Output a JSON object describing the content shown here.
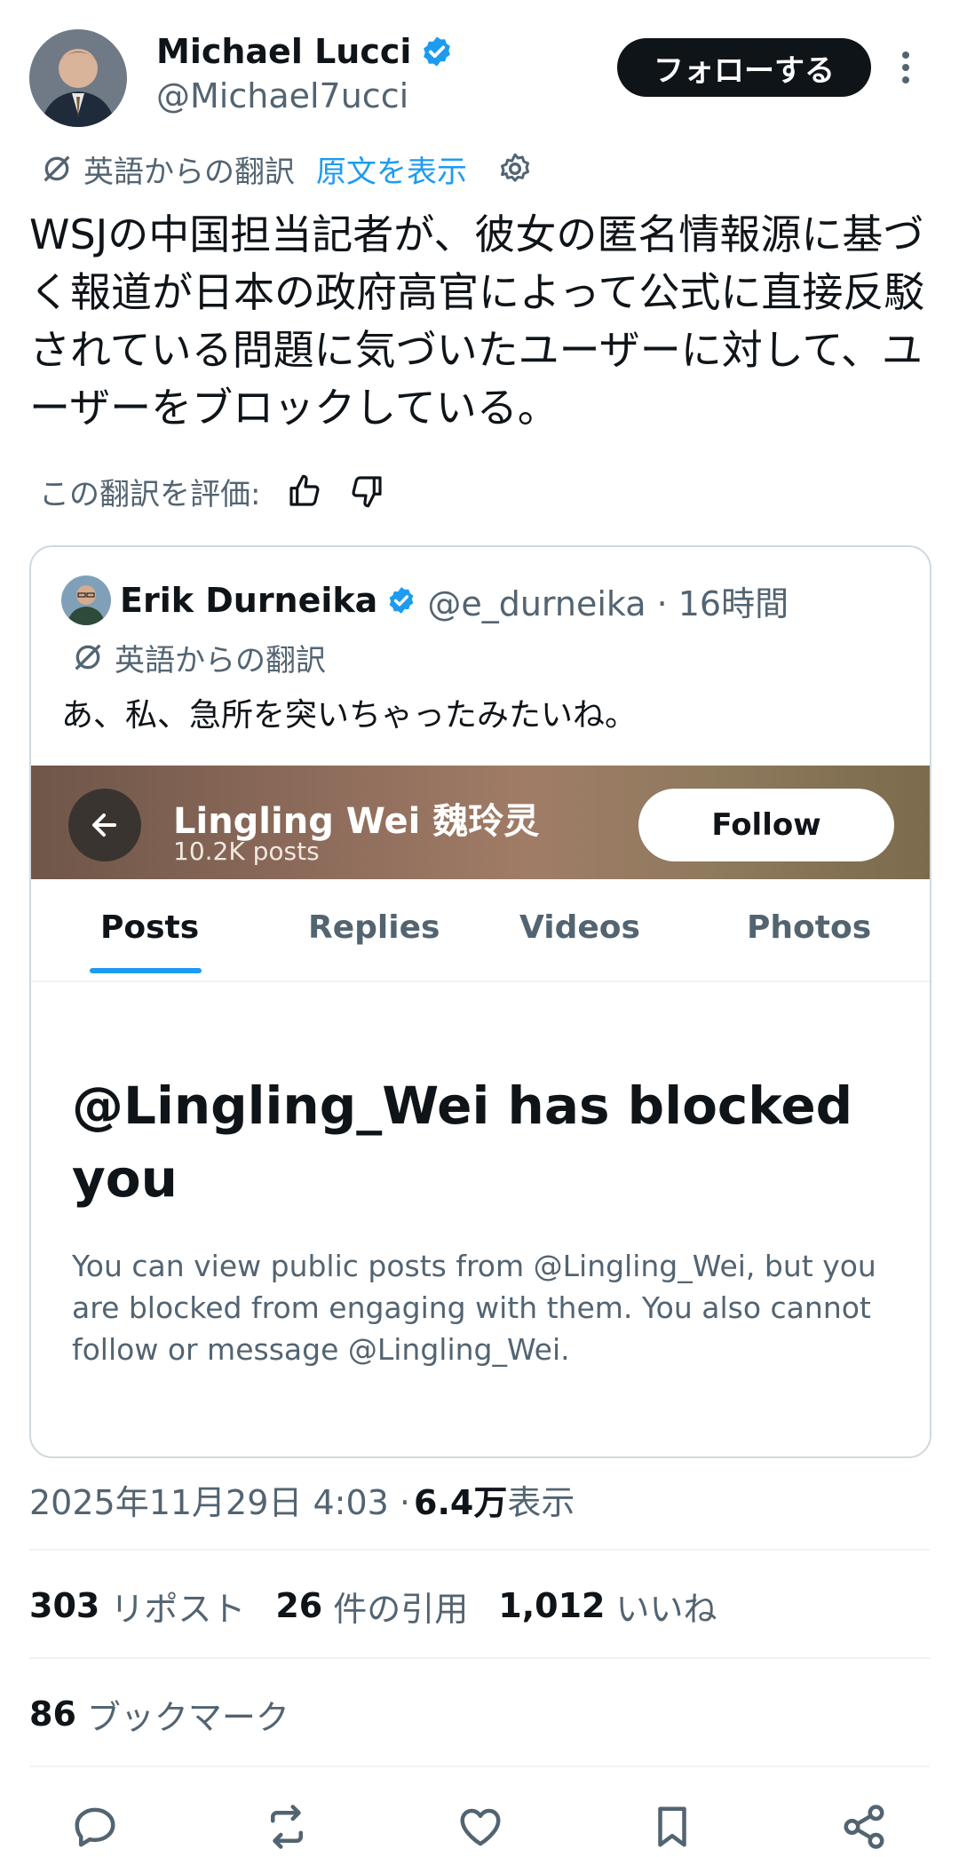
{
  "author": {
    "name": "Michael Lucci",
    "handle": "@Michael7ucci",
    "follow_label": "フォローする"
  },
  "translation": {
    "label": "英語からの翻訳",
    "show_original": "原文を表示"
  },
  "body": "WSJの中国担当記者が、彼女の匿名情報源に基づく報道が日本の政府高官によって公式に直接反駁されている問題に気づいたユーザーに対して、ユーザーをブロックしている。",
  "rate": {
    "label": "この翻訳を評価:"
  },
  "quoted": {
    "name": "Erik Durneika",
    "meta": "@e_durneika · 16時間",
    "translation_label": "英語からの翻訳",
    "text": "あ、私、急所を突いちゃったみたいね。",
    "screenshot": {
      "profile_name": "Lingling Wei 魏玲灵",
      "posts_count": "10.2K posts",
      "follow_label": "Follow",
      "tabs": [
        "Posts",
        "Replies",
        "Videos",
        "Photos"
      ],
      "active_tab": "Posts",
      "blocked_title": "@Lingling_Wei has blocked you",
      "blocked_desc": "You can view public posts from @Lingling_Wei, but you are blocked from engaging with them. You also cannot follow or message @Lingling_Wei."
    }
  },
  "meta": {
    "timestamp": "2025年11月29日 4:03 · ",
    "views_count": "6.4万",
    "views_label": " 表示"
  },
  "stats": {
    "reposts_count": "303",
    "reposts_label": "リポスト",
    "quotes_count": "26",
    "quotes_label": "件の引用",
    "likes_count": "1,012",
    "likes_label": "いいね",
    "bookmarks_count": "86",
    "bookmarks_label": "ブックマーク"
  },
  "colors": {
    "accent": "#1d9bf0",
    "text": "#0f1419",
    "muted": "#536471",
    "border": "#cfd9de"
  }
}
